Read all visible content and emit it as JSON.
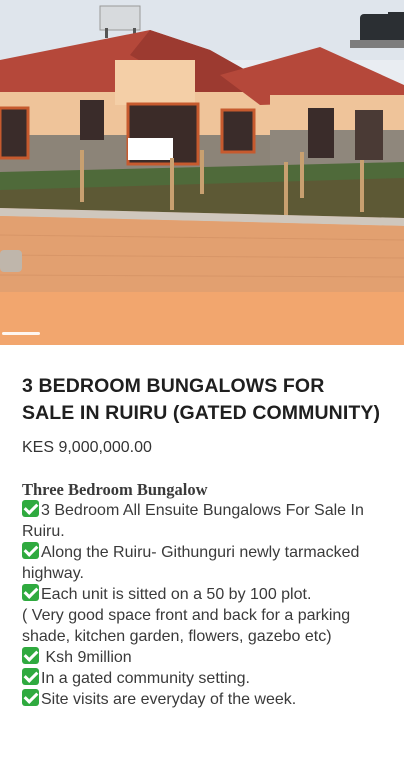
{
  "listing": {
    "title": "3 BEDROOM BUNGALOWS FOR SALE IN RUIRU (GATED COMMUNITY)",
    "price": "KES 9,000,000.00"
  },
  "description": {
    "heading": "Three Bedroom Bungalow",
    "lines": [
      {
        "check": true,
        "text": "3 Bedroom All Ensuite Bungalows For Sale In Ruiru."
      },
      {
        "check": true,
        "text": "Along the Ruiru- Githunguri newly tarmacked highway."
      },
      {
        "check": true,
        "text": "Each unit is sitted on a 50 by 100 plot."
      },
      {
        "check": false,
        "text": "( Very good space front and back for a parking shade, kitchen garden, flowers, gazebo etc)"
      },
      {
        "check": true,
        "text": " Ksh 9million"
      },
      {
        "check": true,
        "text": "In a gated community setting."
      },
      {
        "check": true,
        "text": "Site visits are everyday of the week."
      }
    ]
  },
  "icons": {
    "check": "check-mark-icon"
  },
  "colors": {
    "roof": "#b5483a",
    "wall": "#f0c9a0",
    "paving": "#e2a070",
    "hero_bottom": "#f2a66e",
    "check_green": "#2faa3f"
  }
}
